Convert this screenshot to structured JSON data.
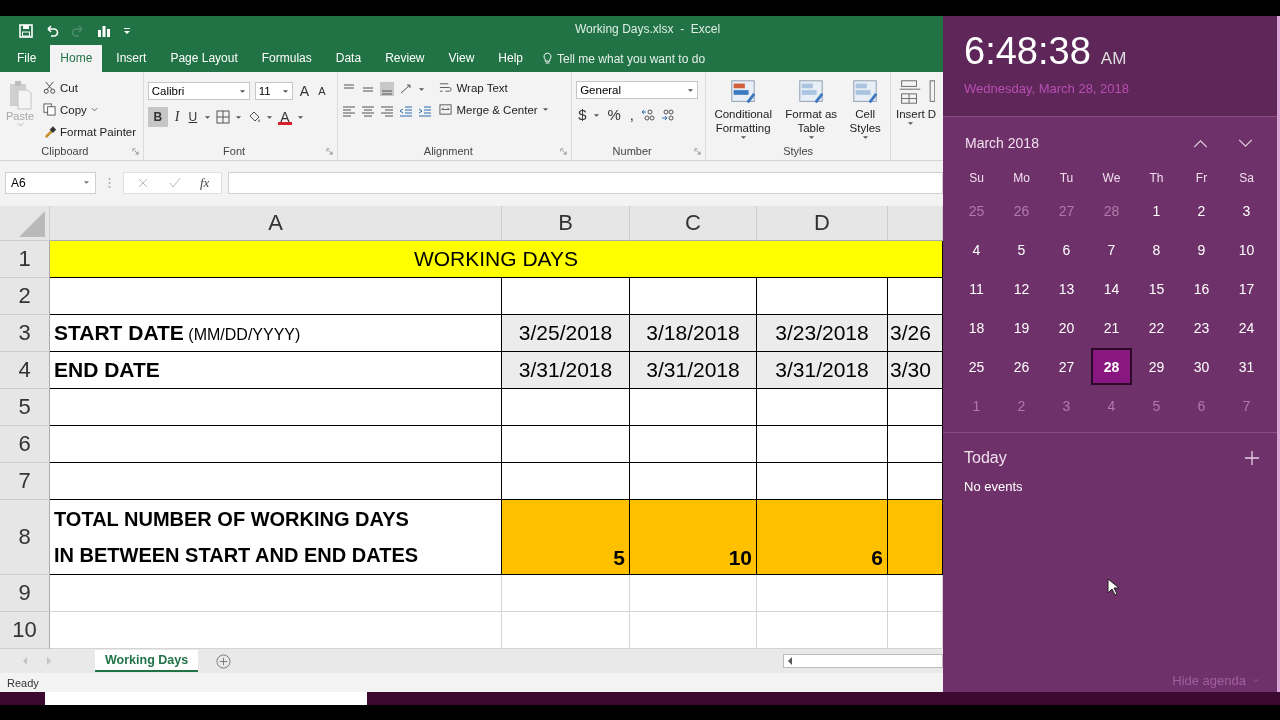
{
  "window": {
    "title": "Working Days.xlsx  -  Excel"
  },
  "quick_access": {
    "undo_enabled": true,
    "redo_enabled": false
  },
  "ribbon_tabs": [
    {
      "label": "File",
      "selected": false
    },
    {
      "label": "Home",
      "selected": true
    },
    {
      "label": "Insert",
      "selected": false
    },
    {
      "label": "Page Layout",
      "selected": false
    },
    {
      "label": "Formulas",
      "selected": false
    },
    {
      "label": "Data",
      "selected": false
    },
    {
      "label": "Review",
      "selected": false
    },
    {
      "label": "View",
      "selected": false
    },
    {
      "label": "Help",
      "selected": false
    }
  ],
  "tell_me": "Tell me what you want to do",
  "ribbon": {
    "clipboard": {
      "paste": "Paste",
      "paste_enabled": false,
      "cut": "Cut",
      "copy": "Copy",
      "format_painter": "Format Painter",
      "label": "Clipboard"
    },
    "font": {
      "font_name": "Calibri",
      "font_size": "11",
      "grow": "A",
      "shrink": "A",
      "bold": "B",
      "bold_on": true,
      "italic": "I",
      "underline": "U",
      "font_color": "A",
      "label": "Font"
    },
    "alignment": {
      "wrap_text": "Wrap Text",
      "merge_center": "Merge & Center",
      "label": "Alignment"
    },
    "number": {
      "format": "General",
      "currency": "$",
      "percent": "%",
      "comma": ",",
      "label": "Number"
    },
    "styles": {
      "buttons": [
        "Conditional Formatting",
        "Format as Table",
        "Cell Styles"
      ],
      "label": "Styles"
    },
    "cells": {
      "insert": "Insert",
      "next_cut": "D"
    }
  },
  "formula_bar": {
    "name_box": "A6",
    "function_label": "fx"
  },
  "sheet": {
    "columns": [
      "A",
      "B",
      "C",
      "D"
    ],
    "rows": [
      {
        "number": "1",
        "kind": "title",
        "text": "WORKING DAYS"
      },
      {
        "number": "2",
        "kind": "blank"
      },
      {
        "number": "3",
        "kind": "data",
        "label": "**START DATE** (MM/DD/YYYY)",
        "cells": [
          "3/25/2018",
          "3/18/2018",
          "3/23/2018",
          "3/26"
        ]
      },
      {
        "number": "4",
        "kind": "data",
        "label": "**END DATE**",
        "cells": [
          "3/31/2018",
          "3/31/2018",
          "3/31/2018",
          "3/30"
        ]
      },
      {
        "number": "5",
        "kind": "blank"
      },
      {
        "number": "6",
        "kind": "blank"
      },
      {
        "number": "7",
        "kind": "blank"
      },
      {
        "number": "8",
        "kind": "total",
        "label_lines": [
          "TOTAL NUMBER OF WORKING DAYS",
          "IN BETWEEN START AND END DATES"
        ],
        "cells": [
          "5",
          "10",
          "6"
        ]
      },
      {
        "number": "9",
        "kind": "empty"
      },
      {
        "number": "10",
        "kind": "empty"
      }
    ]
  },
  "sheet_tabs": [
    {
      "label": "Working Days",
      "selected": true
    }
  ],
  "status_bar": {
    "text": "Ready"
  },
  "clock_panel": {
    "time": "6:48:38",
    "ampm": "AM",
    "date": "Wednesday, March 28, 2018",
    "month": "March 2018",
    "weekdays": [
      "Su",
      "Mo",
      "Tu",
      "We",
      "Th",
      "Fr",
      "Sa"
    ],
    "weeks": [
      [
        {
          "day": "25",
          "in_month": false,
          "selected": false
        },
        {
          "day": "26",
          "in_month": false,
          "selected": false
        },
        {
          "day": "27",
          "in_month": false,
          "selected": false
        },
        {
          "day": "28",
          "in_month": false,
          "selected": false
        },
        {
          "day": "1",
          "in_month": true,
          "selected": false
        },
        {
          "day": "2",
          "in_month": true,
          "selected": false
        },
        {
          "day": "3",
          "in_month": true,
          "selected": false
        }
      ],
      [
        {
          "day": "4",
          "in_month": true,
          "selected": false
        },
        {
          "day": "5",
          "in_month": true,
          "selected": false
        },
        {
          "day": "6",
          "in_month": true,
          "selected": false
        },
        {
          "day": "7",
          "in_month": true,
          "selected": false
        },
        {
          "day": "8",
          "in_month": true,
          "selected": false
        },
        {
          "day": "9",
          "in_month": true,
          "selected": false
        },
        {
          "day": "10",
          "in_month": true,
          "selected": false
        }
      ],
      [
        {
          "day": "11",
          "in_month": true,
          "selected": false
        },
        {
          "day": "12",
          "in_month": true,
          "selected": false
        },
        {
          "day": "13",
          "in_month": true,
          "selected": false
        },
        {
          "day": "14",
          "in_month": true,
          "selected": false
        },
        {
          "day": "15",
          "in_month": true,
          "selected": false
        },
        {
          "day": "16",
          "in_month": true,
          "selected": false
        },
        {
          "day": "17",
          "in_month": true,
          "selected": false
        }
      ],
      [
        {
          "day": "18",
          "in_month": true,
          "selected": false
        },
        {
          "day": "19",
          "in_month": true,
          "selected": false
        },
        {
          "day": "20",
          "in_month": true,
          "selected": false
        },
        {
          "day": "21",
          "in_month": true,
          "selected": false
        },
        {
          "day": "22",
          "in_month": true,
          "selected": false
        },
        {
          "day": "23",
          "in_month": true,
          "selected": false
        },
        {
          "day": "24",
          "in_month": true,
          "selected": false
        }
      ],
      [
        {
          "day": "25",
          "in_month": true,
          "selected": false
        },
        {
          "day": "26",
          "in_month": true,
          "selected": false
        },
        {
          "day": "27",
          "in_month": true,
          "selected": false
        },
        {
          "day": "28",
          "in_month": true,
          "selected": true
        },
        {
          "day": "29",
          "in_month": true,
          "selected": false
        },
        {
          "day": "30",
          "in_month": true,
          "selected": false
        },
        {
          "day": "31",
          "in_month": true,
          "selected": false
        }
      ],
      [
        {
          "day": "1",
          "in_month": false,
          "selected": false
        },
        {
          "day": "2",
          "in_month": false,
          "selected": false
        },
        {
          "day": "3",
          "in_month": false,
          "selected": false
        },
        {
          "day": "4",
          "in_month": false,
          "selected": false
        },
        {
          "day": "5",
          "in_month": false,
          "selected": false
        },
        {
          "day": "6",
          "in_month": false,
          "selected": false
        },
        {
          "day": "7",
          "in_month": false,
          "selected": false
        }
      ]
    ],
    "agenda_title": "Today",
    "agenda_empty": "No events",
    "hide_agenda": "Hide agenda"
  }
}
